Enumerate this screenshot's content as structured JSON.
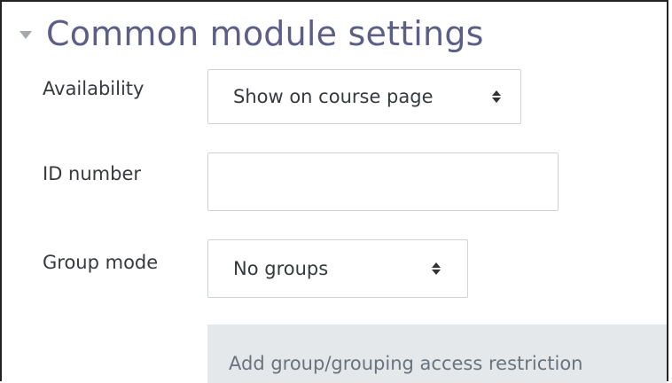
{
  "section": {
    "title": "Common module settings"
  },
  "availability": {
    "label": "Availability",
    "selected": "Show on course page"
  },
  "id_number": {
    "label": "ID number",
    "value": ""
  },
  "group_mode": {
    "label": "Group mode",
    "selected": "No groups"
  },
  "restriction": {
    "button_label": "Add group/grouping access restriction"
  },
  "icons": {
    "section_toggle": "caret-down-icon",
    "select_arrows": "sort-arrows-icon"
  },
  "colors": {
    "title": "#5d5e86",
    "caret": "#a6a9ad",
    "button_bg": "#e5e8eb",
    "button_text": "#6a737b",
    "input_border": "#cfd4d8"
  }
}
